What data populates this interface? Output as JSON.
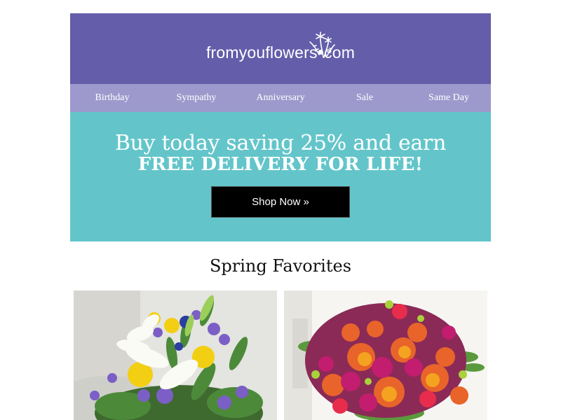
{
  "brand": {
    "logo_prefix": "fromyouflowers",
    "logo_suffix": "com"
  },
  "nav": {
    "items": [
      "Birthday",
      "Sympathy",
      "Anniversary",
      "Sale",
      "Same Day"
    ]
  },
  "hero": {
    "line1": "Buy today saving 25% and earn",
    "line2": "FREE DELIVERY FOR LIFE!",
    "cta_label": "Shop Now »"
  },
  "section": {
    "title": "Spring Favorites"
  },
  "colors": {
    "header": "#645daa",
    "nav": "#9d99cc",
    "hero": "#63c5ca",
    "cta": "#000000"
  },
  "products": [
    {
      "image": "bouquet-lilies-roses-photo"
    },
    {
      "image": "bouquet-orange-magenta-photo"
    }
  ]
}
